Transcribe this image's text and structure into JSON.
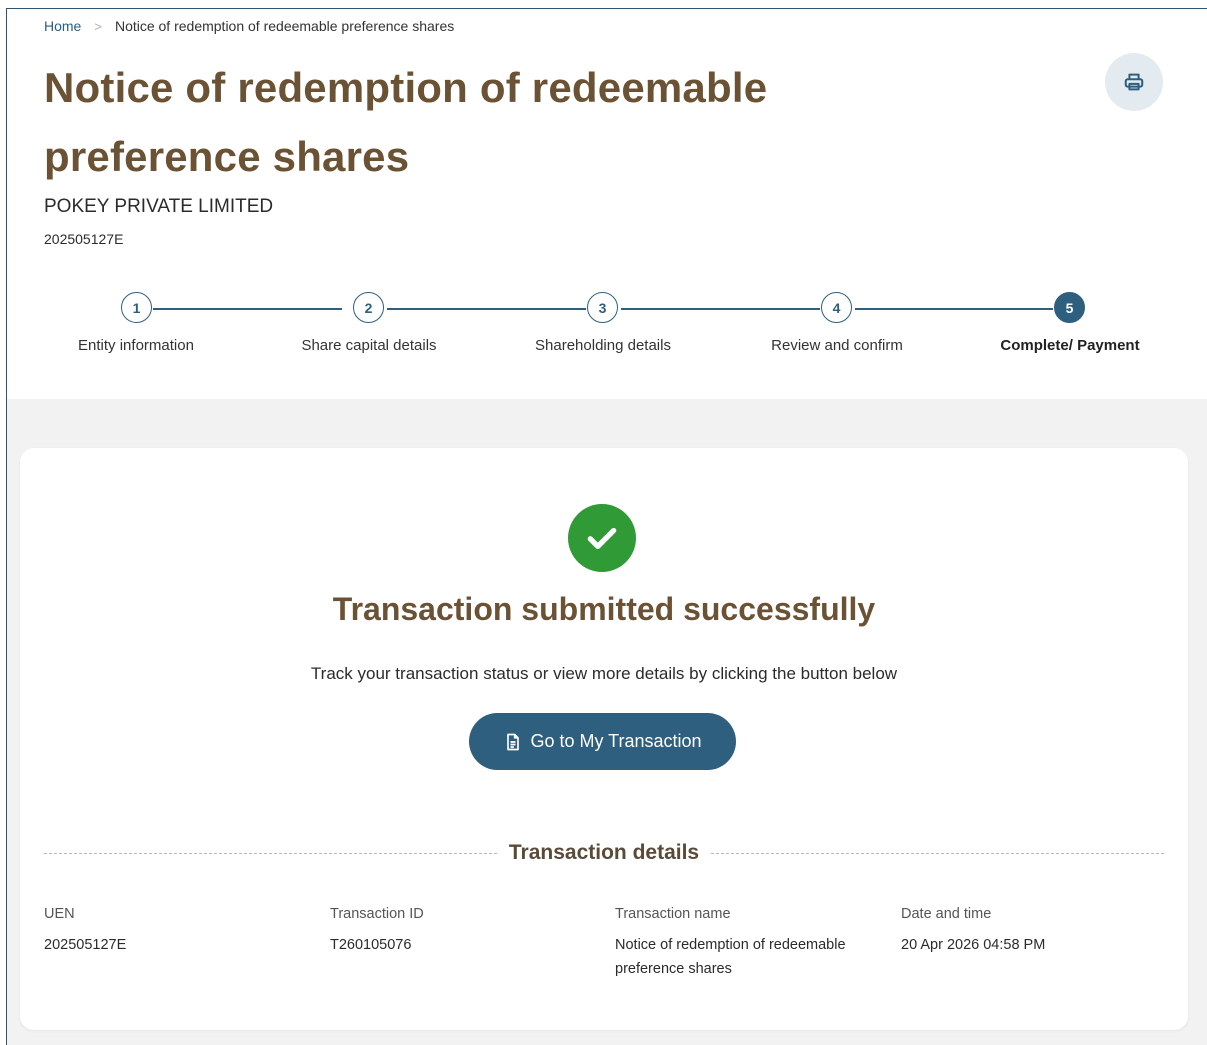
{
  "breadcrumb": {
    "home": "Home",
    "separator": ">",
    "current": "Notice of redemption of redeemable preference shares"
  },
  "page": {
    "title": "Notice of redemption of redeemable preference shares",
    "print_icon": "printer-icon"
  },
  "entity": {
    "name": "POKEY PRIVATE LIMITED",
    "uen": "202505127E"
  },
  "stepper": {
    "current_step": 5,
    "steps": [
      {
        "number": "1",
        "label": "Entity information"
      },
      {
        "number": "2",
        "label": "Share capital details"
      },
      {
        "number": "3",
        "label": "Shareholding details"
      },
      {
        "number": "4",
        "label": "Review and confirm"
      },
      {
        "number": "5",
        "label": "Complete/ Payment"
      }
    ]
  },
  "success": {
    "icon": "check-circle-icon",
    "title": "Transaction submitted successfully",
    "description": "Track your transaction status or view more details by clicking the button below",
    "button_label": "Go to My Transaction",
    "button_icon": "document-icon"
  },
  "details": {
    "section_title": "Transaction details",
    "fields": [
      {
        "label": "UEN",
        "value": "202505127E"
      },
      {
        "label": "Transaction ID",
        "value": "T260105076"
      },
      {
        "label": "Transaction name",
        "value": "Notice of redemption of redeemable preference shares"
      },
      {
        "label": "Date and time",
        "value": "20 Apr 2026 04:58 PM"
      }
    ]
  },
  "colors": {
    "primary": "#2f5f7e",
    "title_brown": "#6b5234",
    "success_green": "#2f9a36",
    "background_grey": "#f2f2f2"
  }
}
